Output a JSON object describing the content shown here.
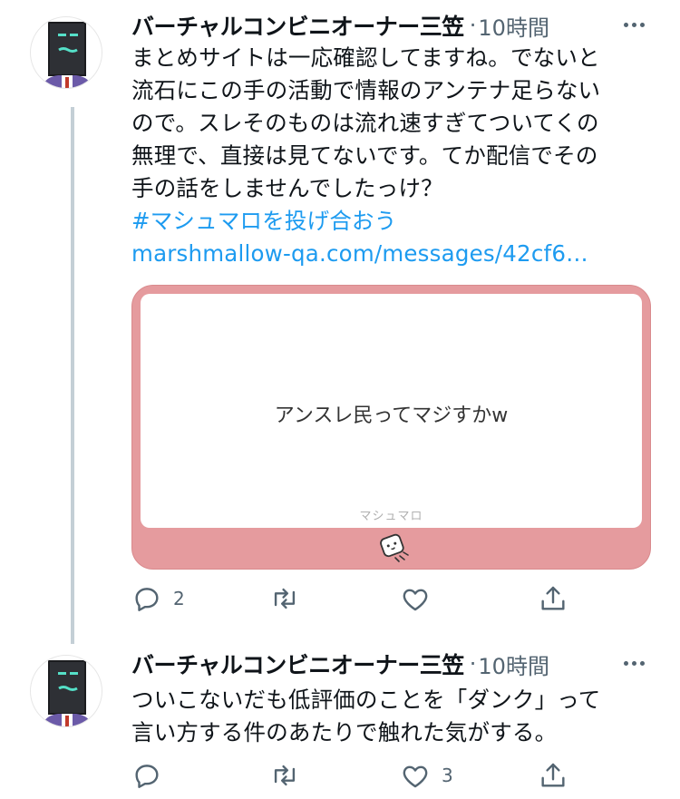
{
  "tweets": [
    {
      "author": "バーチャルコンビニオーナー三笠",
      "time": "10時間",
      "lines": [
        "まとめサイトは一応確認してますね。でないと",
        "流石にこの手の活動で情報のアンテナ足らない",
        "ので。スレそのものは流れ速すぎてついてくの",
        "無理で、直接は見てないです。てか配信でその",
        "手の話をしませんでしたっけ？"
      ],
      "hashtag": "#マシュマロを投げ合おう",
      "link": "marshmallow-qa.com/messages/42cf6…",
      "card": {
        "question": "アンスレ民ってマジすかw",
        "brand": "マシュマロ",
        "bg_color": "#e59b9e"
      },
      "actions": {
        "reply_count": "2",
        "retweet_count": "",
        "like_count": ""
      }
    },
    {
      "author": "バーチャルコンビニオーナー三笠",
      "time": "10時間",
      "lines": [
        "ついこないだも低評価のことを「ダンク」って",
        "言い方する件のあたりで触れた気がする。"
      ],
      "actions": {
        "reply_count": "",
        "retweet_count": "",
        "like_count": "3"
      }
    }
  ],
  "meta_separator": "·",
  "icons": [
    "more-icon",
    "reply-icon",
    "retweet-icon",
    "like-icon",
    "share-icon"
  ],
  "colors": {
    "link": "#1d9bf0",
    "secondary": "#536471",
    "thread_line": "#c4cfd6"
  }
}
